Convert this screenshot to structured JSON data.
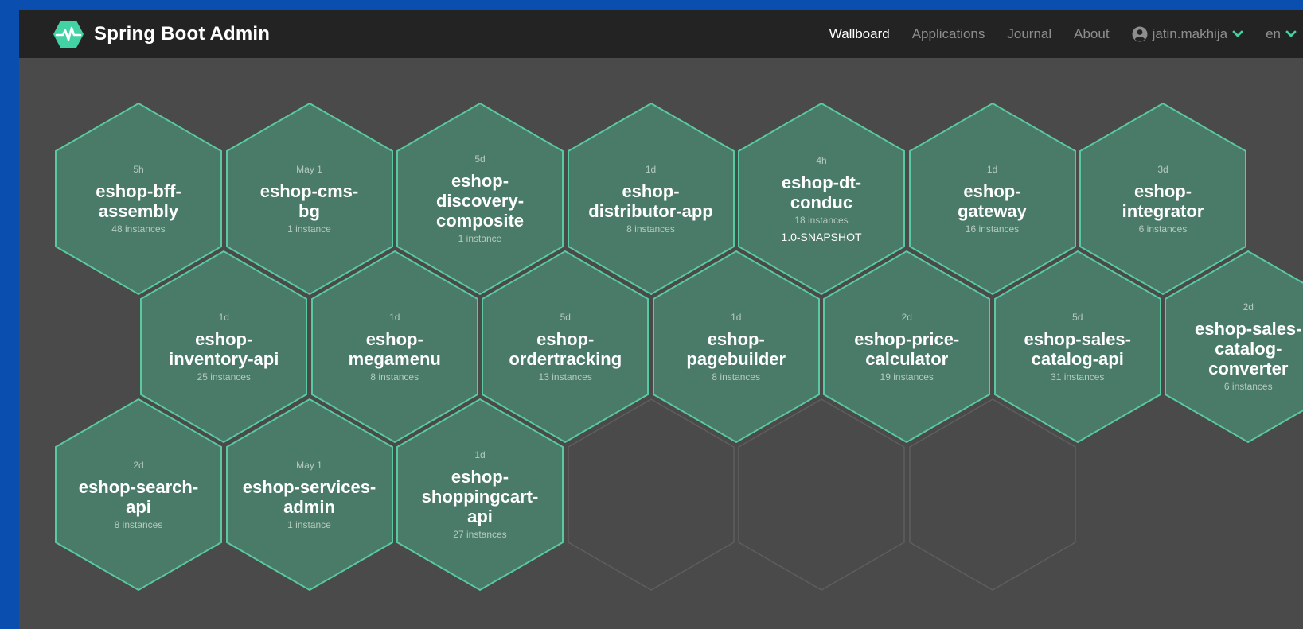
{
  "brand": {
    "title": "Spring Boot Admin",
    "icon": "heartbeat-icon",
    "accent": "#42d3a5"
  },
  "nav": {
    "wallboard": "Wallboard",
    "applications": "Applications",
    "journal": "Journal",
    "about": "About",
    "user": "jatin.makhija",
    "language": "en"
  },
  "colors": {
    "tile_fill": "#4a7a68",
    "tile_stroke": "#58c9a0",
    "empty_stroke": "#5e5e5e",
    "page_bg": "#4a4a4a",
    "navbar_bg": "#232323"
  },
  "apps": [
    {
      "name": "eshop-bff-\nassembly",
      "time": "5h",
      "instances": "48 instances",
      "version": ""
    },
    {
      "name": "eshop-cms-\nbg",
      "time": "May 1",
      "instances": "1 instance",
      "version": ""
    },
    {
      "name": "eshop-\ndiscovery-\ncomposite",
      "time": "5d",
      "instances": "1 instance",
      "version": ""
    },
    {
      "name": "eshop-\ndistributor-app",
      "time": "1d",
      "instances": "8 instances",
      "version": ""
    },
    {
      "name": "eshop-dt-\nconduc",
      "time": "4h",
      "instances": "18 instances",
      "version": "1.0-SNAPSHOT"
    },
    {
      "name": "eshop-\ngateway",
      "time": "1d",
      "instances": "16 instances",
      "version": ""
    },
    {
      "name": "eshop-\nintegrator",
      "time": "3d",
      "instances": "6 instances",
      "version": ""
    },
    {
      "name": "eshop-\ninventory-api",
      "time": "1d",
      "instances": "25 instances",
      "version": ""
    },
    {
      "name": "eshop-\nmegamenu",
      "time": "1d",
      "instances": "8 instances",
      "version": ""
    },
    {
      "name": "eshop-\nordertracking",
      "time": "5d",
      "instances": "13 instances",
      "version": ""
    },
    {
      "name": "eshop-\npagebuilder",
      "time": "1d",
      "instances": "8 instances",
      "version": ""
    },
    {
      "name": "eshop-price-\ncalculator",
      "time": "2d",
      "instances": "19 instances",
      "version": ""
    },
    {
      "name": "eshop-sales-\ncatalog-api",
      "time": "5d",
      "instances": "31 instances",
      "version": ""
    },
    {
      "name": "eshop-sales-\ncatalog-\nconverter",
      "time": "2d",
      "instances": "6 instances",
      "version": ""
    },
    {
      "name": "eshop-search-\napi",
      "time": "2d",
      "instances": "8 instances",
      "version": ""
    },
    {
      "name": "eshop-services-\nadmin",
      "time": "May 1",
      "instances": "1 instance",
      "version": ""
    },
    {
      "name": "eshop-\nshoppingcart-\napi",
      "time": "1d",
      "instances": "27 instances",
      "version": ""
    }
  ]
}
